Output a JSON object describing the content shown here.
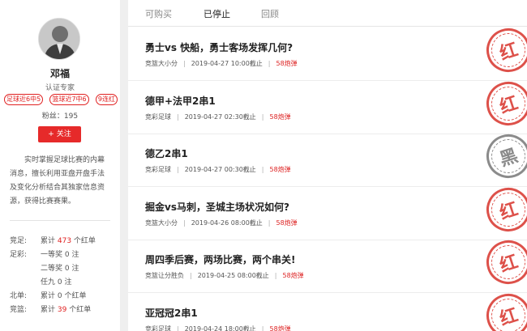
{
  "profile": {
    "name": "邓福",
    "role": "认证专家",
    "tags": [
      "足球近6中5",
      "篮球近7中6",
      "9连红"
    ],
    "fans": "粉丝：195",
    "follow_label": "+ 关注",
    "intro": "实时掌握足球比赛的内幕消息，擅长利用亚盘开盘手法及变化分析结合其独家信息资源，获得比赛赛果。"
  },
  "stats": [
    {
      "label": "竞足:",
      "pre": "累计 ",
      "num": "473",
      "post": " 个红单"
    },
    {
      "label": "足彩:",
      "pre": "一等奖 0 注",
      "num": "",
      "post": ""
    },
    {
      "label": "",
      "pre": "二等奖 0 注",
      "num": "",
      "post": ""
    },
    {
      "label": "",
      "pre": "任九 0 注",
      "num": "",
      "post": ""
    },
    {
      "label": "北单:",
      "pre": "累计 0 个红单",
      "num": "",
      "post": ""
    },
    {
      "label": "竞篮:",
      "pre": "累计 ",
      "num": "39",
      "post": " 个红单"
    }
  ],
  "tabs": [
    "可购买",
    "已停止",
    "回顾"
  ],
  "active_tab": "已停止",
  "items": [
    {
      "title": "勇士vs 快船，勇士客场发挥几何?",
      "category": "竞篮大小分",
      "deadline": "2019-04-27 10:00截止",
      "price": "58炮弹",
      "stamp": "红",
      "stamp_color": "red"
    },
    {
      "title": "德甲+法甲2串1",
      "category": "竞彩足球",
      "deadline": "2019-04-27 02:30截止",
      "price": "58炮弹",
      "stamp": "红",
      "stamp_color": "red"
    },
    {
      "title": "德乙2串1",
      "category": "竞彩足球",
      "deadline": "2019-04-27 00:30截止",
      "price": "58炮弹",
      "stamp": "黑",
      "stamp_color": "black"
    },
    {
      "title": "掘金vs马刺，圣城主场状况如何?",
      "category": "竞篮大小分",
      "deadline": "2019-04-26 08:00截止",
      "price": "58炮弹",
      "stamp": "红",
      "stamp_color": "red"
    },
    {
      "title": "周四季后赛，两场比赛，两个串关!",
      "category": "竞篮让分胜负",
      "deadline": "2019-04-25 08:00截止",
      "price": "58炮弹",
      "stamp": "红",
      "stamp_color": "red"
    },
    {
      "title": "亚冠冠2串1",
      "category": "竞彩足球",
      "deadline": "2019-04-24 18:00截止",
      "price": "58炮弹",
      "stamp": "红",
      "stamp_color": "red"
    }
  ],
  "colors": {
    "accent": "#e62a2a",
    "stamp_red": "#d8332b",
    "stamp_black": "#777777"
  }
}
